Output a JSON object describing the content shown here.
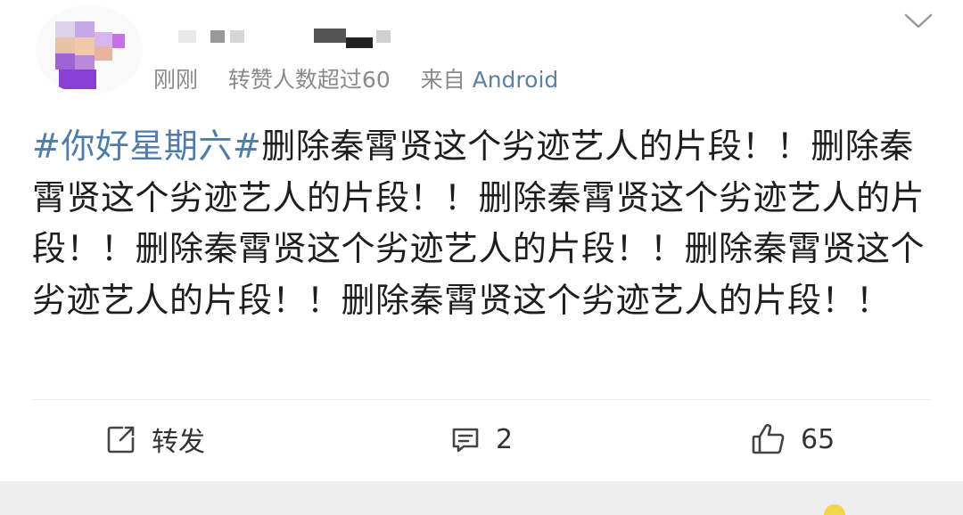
{
  "post": {
    "meta": {
      "time": "刚刚",
      "reposts": "转赞人数超过60",
      "source_prefix": "来自",
      "source": "Android"
    },
    "topic": "#你好星期六#",
    "text": "删除秦霄贤这个劣迹艺人的片段！！删除秦霄贤这个劣迹艺人的片段！！删除秦霄贤这个劣迹艺人的片段！！删除秦霄贤这个劣迹艺人的片段！！删除秦霄贤这个劣迹艺人的片段！！删除秦霄贤这个劣迹艺人的片段！！"
  },
  "actions": {
    "repost_label": "转发",
    "comment_count": "2",
    "like_count": "65"
  },
  "icons": {
    "menu": "chevron-down-icon",
    "repost": "edit-icon",
    "comment": "comment-icon",
    "like": "thumbs-up-icon"
  },
  "colors": {
    "topic": "#4f7ca8",
    "meta": "#8a8a8a",
    "source": "#5f7fa3"
  }
}
